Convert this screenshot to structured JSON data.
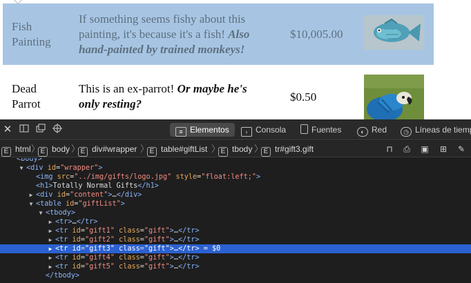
{
  "page": {
    "rows": [
      {
        "name_line1": "Fish",
        "name_line2": "Painting",
        "desc_plain_1": "If something seems fishy about this",
        "desc_plain_2": "painting, it's because it's a fish!",
        "desc_bold_1": "Also",
        "desc_bold_2": "hand-painted by trained monkeys!",
        "price": "$10,005.00",
        "image": "fish-painting"
      },
      {
        "name_line1": "Dead",
        "name_line2": "Parrot",
        "desc_plain_1": "This is an ex-parrot!",
        "desc_bold_1": "Or maybe he's",
        "desc_bold_2": "only resting?",
        "price": "$0.50",
        "image": "parrot-photo"
      }
    ],
    "colors": {
      "selected_row": "#a7c5e3"
    }
  },
  "devtools": {
    "toolbar_icons": [
      "close-icon",
      "dock-side-icon",
      "undock-icon",
      "element-picker-icon"
    ],
    "tabs": [
      {
        "label": "Elementos",
        "icon": "elements-icon",
        "active": true
      },
      {
        "label": "Consola",
        "icon": "console-icon"
      },
      {
        "label": "Fuentes",
        "icon": "sources-icon"
      },
      {
        "label": "Red",
        "icon": "network-icon"
      },
      {
        "label": "Líneas de tiemp",
        "icon": "timelines-icon"
      }
    ],
    "breadcrumb": [
      "html",
      "body",
      "div#wrapper",
      "table#giftList",
      "tbody",
      "tr#gift3.gift"
    ],
    "right_icons": [
      "layout-icon",
      "print-icon",
      "screen-icon",
      "grid-icon",
      "pencil-icon"
    ],
    "tree": [
      {
        "tw": "",
        "tag_open": "<body>",
        "partial": true
      },
      {
        "tw": "▼",
        "tag": "div",
        "attrs": [
          {
            "n": "id",
            "v": "\"wrapper\""
          }
        ]
      },
      {
        "tw": "",
        "tag": "img",
        "attrs": [
          {
            "n": "src",
            "v": "\"../img/gifts/logo.jpg\""
          },
          {
            "n": "style",
            "v": "\"float:left;\""
          }
        ]
      },
      {
        "tw": "",
        "tag": "h1",
        "text": "Totally Normal Gifts",
        "close": "</h1>"
      },
      {
        "tw": "▶",
        "tag": "div",
        "attrs": [
          {
            "n": "id",
            "v": "\"content\""
          }
        ],
        "text": "…",
        "close": "</div>"
      },
      {
        "tw": "▼",
        "tag": "table",
        "attrs": [
          {
            "n": "id",
            "v": "\"giftList\""
          }
        ]
      },
      {
        "tw": "▼",
        "tag": "tbody"
      },
      {
        "tw": "▶",
        "tag": "tr",
        "text": "…",
        "close": "</tr>"
      },
      {
        "tw": "▶",
        "tag": "tr",
        "attrs": [
          {
            "n": "id",
            "v": "\"gift1\""
          },
          {
            "n": "class",
            "v": "\"gift\""
          }
        ],
        "text": "…",
        "close": "</tr>"
      },
      {
        "tw": "▶",
        "tag": "tr",
        "attrs": [
          {
            "n": "id",
            "v": "\"gift2\""
          },
          {
            "n": "class",
            "v": "\"gift\""
          }
        ],
        "text": "…",
        "close": "</tr>"
      },
      {
        "tw": "▶",
        "tag": "tr",
        "attrs": [
          {
            "n": "id",
            "v": "\"gift3\""
          },
          {
            "n": "class",
            "v": "\"gift\""
          }
        ],
        "text": "…",
        "close": "</tr>",
        "selected": true,
        "suffix": " = $0"
      },
      {
        "tw": "▶",
        "tag": "tr",
        "attrs": [
          {
            "n": "id",
            "v": "\"gift4\""
          },
          {
            "n": "class",
            "v": "\"gift\""
          }
        ],
        "text": "…",
        "close": "</tr>"
      },
      {
        "tw": "▶",
        "tag": "tr",
        "attrs": [
          {
            "n": "id",
            "v": "\"gift5\""
          },
          {
            "n": "class",
            "v": "\"gift\""
          }
        ],
        "text": "…",
        "close": "</tr>"
      },
      {
        "tw": "",
        "tag_close_only": "</tbody>"
      }
    ]
  }
}
